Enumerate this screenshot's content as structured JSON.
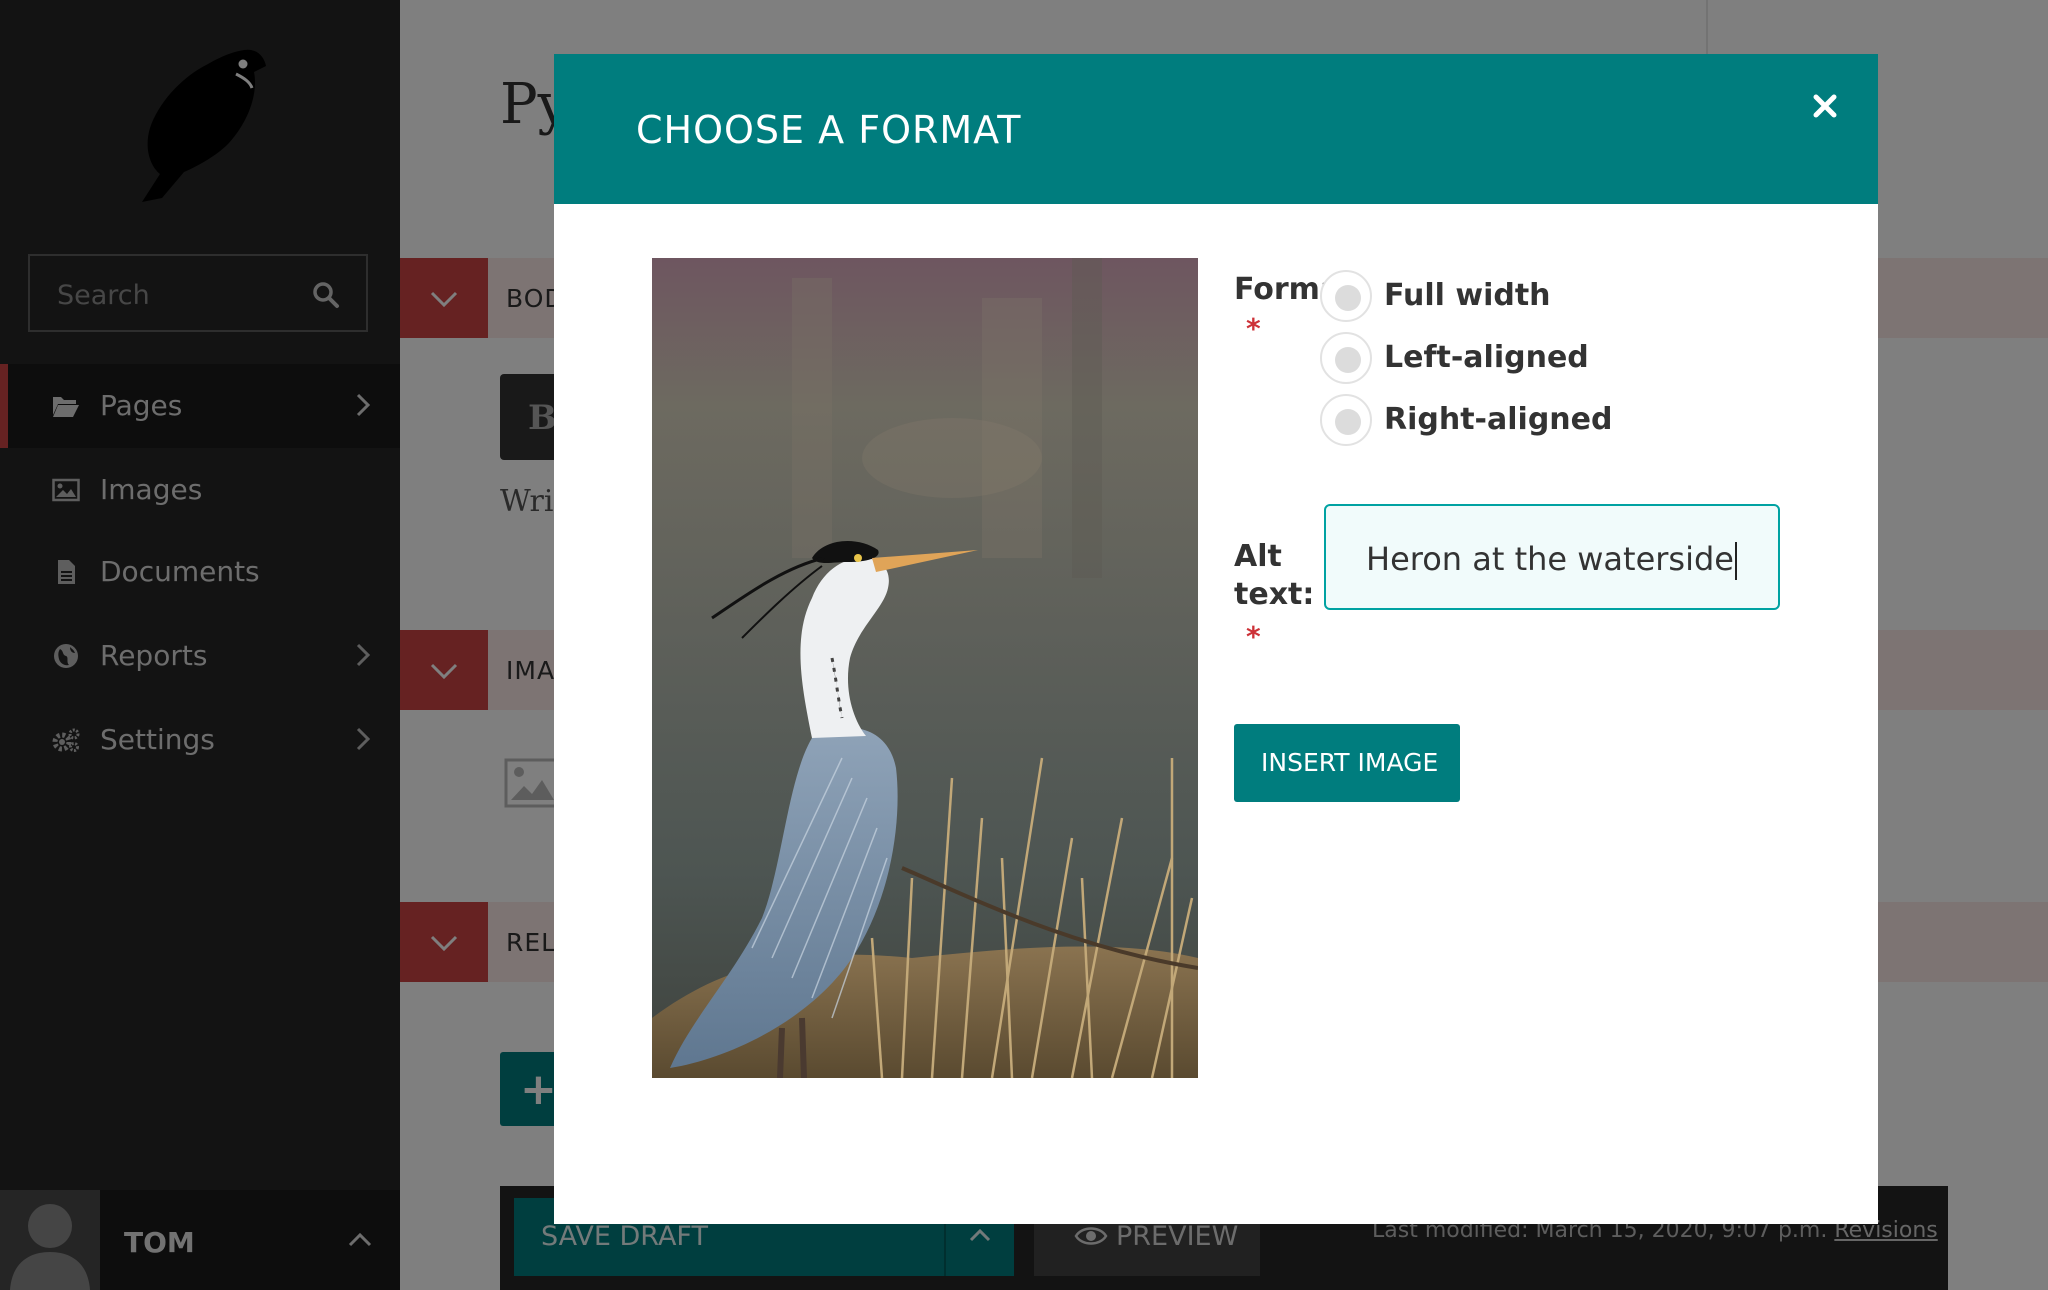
{
  "sidebar": {
    "search_placeholder": "Search",
    "items": [
      {
        "label": "Pages"
      },
      {
        "label": "Images"
      },
      {
        "label": "Documents"
      },
      {
        "label": "Reports"
      },
      {
        "label": "Settings"
      }
    ],
    "user_name": "TOM"
  },
  "main": {
    "page_title": "Py",
    "panels": [
      "BOD",
      "IMA",
      "REL"
    ],
    "bold_label": "B",
    "body_placeholder": "Wri",
    "add_label": "+"
  },
  "footer": {
    "save_draft": "SAVE DRAFT",
    "preview": "PREVIEW",
    "last_modified": "Last modified: March 15, 2020, 9:07 p.m.",
    "revisions": "Revisions"
  },
  "modal": {
    "title": "CHOOSE A FORMAT",
    "format_label": "Format",
    "required_mark": "*",
    "formats": [
      "Full width",
      "Left-aligned",
      "Right-aligned"
    ],
    "alt_label_line1": "Alt",
    "alt_label_line2": "text:",
    "alt_value": "Heron at the waterside",
    "insert_button": "INSERT IMAGE"
  },
  "colors": {
    "teal": "#007d7e",
    "red": "#cd4444",
    "sidebar": "#262626"
  }
}
